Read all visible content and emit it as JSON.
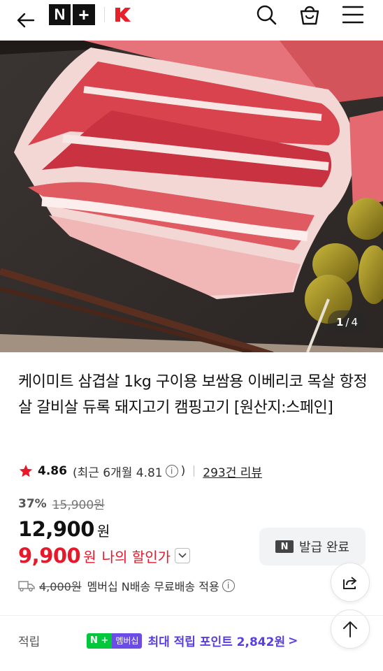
{
  "header": {
    "logo_text_n": "N",
    "logo_text_plus": "+",
    "icons": [
      "back-arrow-icon",
      "search-icon",
      "cart-bag-icon",
      "menu-icon"
    ]
  },
  "gallery": {
    "current": "1",
    "separator": "/",
    "total": "4"
  },
  "product": {
    "title": "케이미트 삼겹살 1kg 구이용 보쌈용 이베리코 목살 항정살 갈비살 듀록 돼지고기 캠핑고기 [원산지:스페인]",
    "rating": "4.86",
    "recent_label": "(최근 6개월 4.81",
    "recent_close": ")",
    "info_glyph": "i",
    "reviews": "293건 리뷰",
    "discount": "37%",
    "original_price": "15,900원",
    "price": "12,900",
    "price_unit": "원",
    "my_price": "9,900",
    "my_price_unit": "원",
    "my_price_label": "나의 할인가"
  },
  "coupon": {
    "badge": "N",
    "label": "발급 완료"
  },
  "shipping": {
    "original": "4,000원",
    "text": "멤버십 N배송 무료배송 적용"
  },
  "points": {
    "label": "적립",
    "badge_a": "N + ",
    "badge_b": "멤버십",
    "text": "최대 적립 포인트 2,842원",
    "arrow": ">"
  },
  "colors": {
    "sale_red": "#e6192b",
    "membership_purple": "#5a3ee0",
    "n_green": "#00c73c"
  }
}
